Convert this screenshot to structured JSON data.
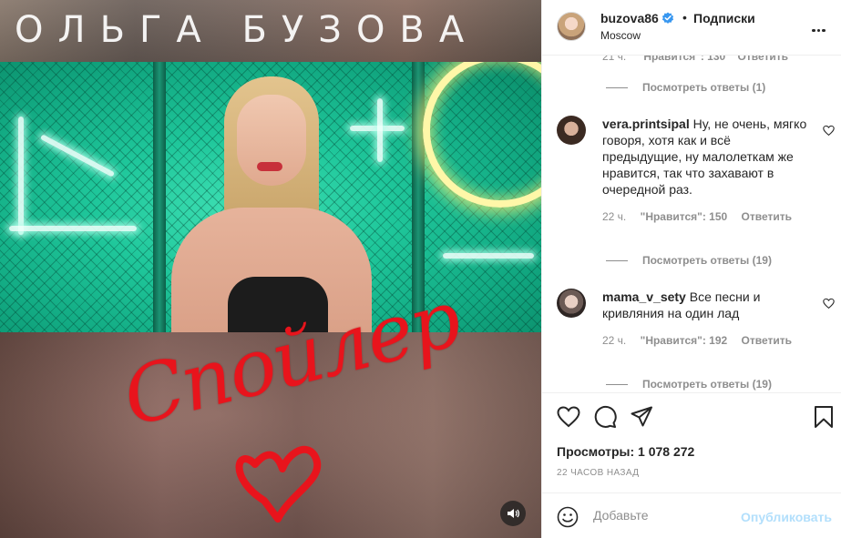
{
  "media": {
    "artist_title": "ОЛЬГА БУЗОВА",
    "song_title": "Спойлер"
  },
  "post_header": {
    "username": "buzova86",
    "separator": "•",
    "follow_label": "Подписки",
    "location": "Moscow"
  },
  "comments": {
    "clipped_line": {
      "time": "21 ч.",
      "likes": "\"Нравится\": 130",
      "reply": "Ответить"
    },
    "items": [
      {
        "view_replies_before": "Посмотреть ответы (1)",
        "username": "vera.printsipal",
        "text": "Ну, не очень, мягко говоря, хотя как и всё предыдущие, ну малолеткам же нравится, так что захавают в очередной раз.",
        "time": "22 ч.",
        "likes": "\"Нравится\": 150",
        "reply": "Ответить",
        "view_replies_after": "Посмотреть ответы (19)"
      },
      {
        "username": "mama_v_sety",
        "text": "Все песни и кривляния на один лад",
        "time": "22 ч.",
        "likes": "\"Нравится\": 192",
        "reply": "Ответить",
        "view_replies_after": "Посмотреть ответы (19)"
      }
    ]
  },
  "stats": {
    "views": "Просмотры: 1 078 272",
    "time_ago": "22 ЧАСОВ НАЗАД"
  },
  "add_comment": {
    "placeholder": "Добавьте",
    "post_label": "Опубликовать"
  },
  "colors": {
    "text": "#262626",
    "muted": "#8e8e8e",
    "verified": "#3897f0",
    "post_disabled": "#b2dffc",
    "script_red": "#e8141c"
  },
  "icons": [
    "verified-icon",
    "more-icon",
    "heart-icon",
    "comment-icon",
    "share-icon",
    "bookmark-icon",
    "emoji-icon",
    "sound-icon"
  ]
}
